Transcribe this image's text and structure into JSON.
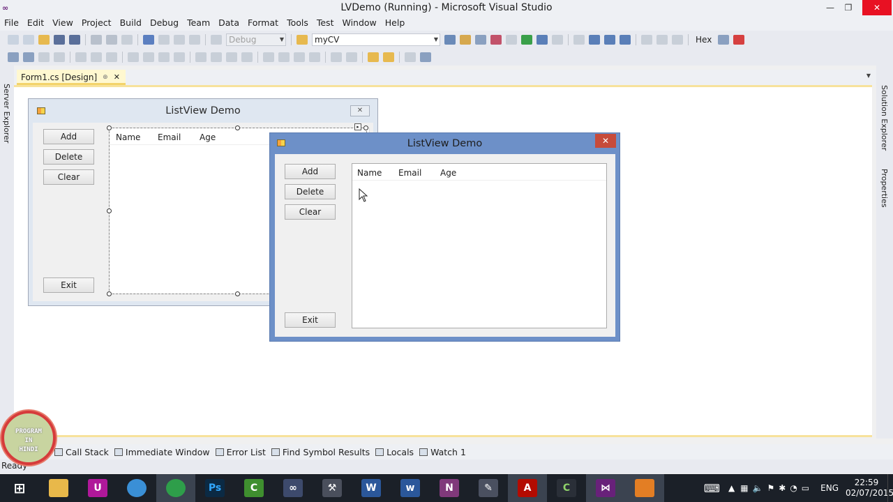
{
  "window": {
    "title": "LVDemo (Running) - Microsoft Visual Studio",
    "vs_logo": "∞"
  },
  "menu": [
    "File",
    "Edit",
    "View",
    "Project",
    "Build",
    "Debug",
    "Team",
    "Data",
    "Format",
    "Tools",
    "Test",
    "Window",
    "Help"
  ],
  "toolbar": {
    "config": "Debug",
    "startup": "myCV",
    "hex_label": "Hex"
  },
  "side_tabs": {
    "left": "Server Explorer",
    "right_1": "Solution Explorer",
    "right_2": "Properties"
  },
  "doc_tab": {
    "label": "Form1.cs [Design]",
    "close": "✕"
  },
  "design_form": {
    "title": "ListView Demo",
    "buttons": {
      "add": "Add",
      "delete": "Delete",
      "clear": "Clear",
      "exit": "Exit"
    },
    "columns": [
      "Name",
      "Email",
      "Age"
    ]
  },
  "run_form": {
    "title": "ListView Demo",
    "close": "✕",
    "buttons": {
      "add": "Add",
      "delete": "Delete",
      "clear": "Clear",
      "exit": "Exit"
    },
    "columns": [
      "Name",
      "Email",
      "Age"
    ]
  },
  "bottom_tabs": [
    "Call Stack",
    "Immediate Window",
    "Error List",
    "Find Symbol Results",
    "Locals",
    "Watch 1"
  ],
  "status": "Ready",
  "badge": {
    "line1": "PROGRAM",
    "line2": "IN",
    "line3": "HINDI"
  },
  "taskbar": {
    "apps": [
      {
        "name": "start",
        "label": "⊞",
        "color": "#1b2028"
      },
      {
        "name": "explorer",
        "label": "▭",
        "color": "#e8b84a"
      },
      {
        "name": "app-purple",
        "label": "U",
        "color": "#b0189a"
      },
      {
        "name": "browser-safari",
        "label": "◎",
        "color": "#3a8fd6"
      },
      {
        "name": "chrome",
        "label": "◉",
        "color": "#2e9e4a"
      },
      {
        "name": "photoshop",
        "label": "Ps",
        "color": "#0b2a44"
      },
      {
        "name": "camtasia",
        "label": "C",
        "color": "#3f8f2f"
      },
      {
        "name": "vs-glasses",
        "label": "∞",
        "color": "#3d4a6c"
      },
      {
        "name": "tools",
        "label": "⚒",
        "color": "#4a4f5c"
      },
      {
        "name": "word",
        "label": "W",
        "color": "#2b579a"
      },
      {
        "name": "word-2",
        "label": "W",
        "color": "#2b579a"
      },
      {
        "name": "onenote",
        "label": "N",
        "color": "#80397b"
      },
      {
        "name": "utility",
        "label": "✎",
        "color": "#4a5060"
      },
      {
        "name": "acrobat",
        "label": "A",
        "color": "#b30b00"
      },
      {
        "name": "camtasia-2",
        "label": "C",
        "color": "#2a2f38"
      },
      {
        "name": "visual-studio",
        "label": "⋈",
        "color": "#68217a"
      },
      {
        "name": "running-app",
        "label": "▣",
        "color": "#e37e24"
      }
    ],
    "lang": "ENG",
    "time": "22:59",
    "date": "02/07/2015"
  }
}
